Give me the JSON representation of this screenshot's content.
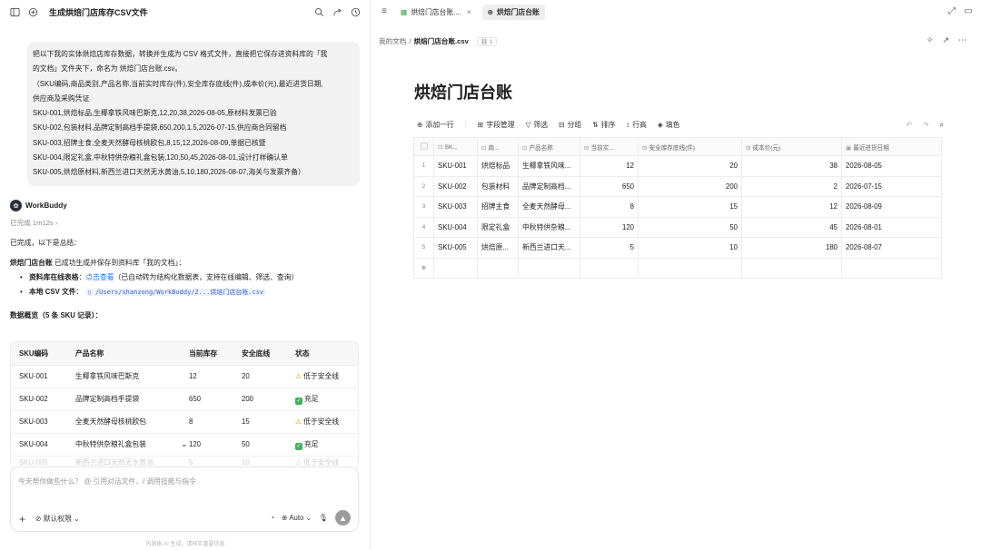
{
  "left_header": {
    "title": "生成烘焙门店库存CSV文件"
  },
  "user_message": {
    "lines": [
      "把以下我的实体烘焙店库存数据，转换并生成为 CSV 格式文件，直接把它保存进资料库的「我",
      "的文档」文件夹下，命名为 烘焙门店台账.csv。",
      "（SKU编码,商品类别,产品名称,当前实时库存(件),安全库存底线(件),成本价(元),最近进货日期,",
      "供应商及采购凭证",
      "SKU-001,烘焙标品,生椰拿铁风味巴斯克,12,20,38,2026-08-05,原材料发票已验",
      "SKU-002,包装材料,品牌定制高档手提袋,650,200,1.5,2026-07-15,供应商合同留档",
      "SKU-003,招牌主食,全麦天然酵母核桃欧包,8,15,12,2026-08-09,单据已核暨",
      "SKU-004,限定礼盒,中秋特供杂粮礼盒包装,120,50,45,2026-08-01,设计打样确认单",
      "SKU-005,烘焙原材料,新西兰进口天然无水黄油,5,10,180,2026-08-07,海关与发票齐备）"
    ]
  },
  "agent": {
    "name": "WorkBuddy",
    "status": "已完成 1m12s",
    "summary_intro": "已完成，以下是总结：",
    "result_title": "烘焙门店台账",
    "result_text": " 已成功生成并保存到资料库「我的文档」：",
    "bullet1_label": "资料库在线表格",
    "bullet1_link": "点击查看",
    "bullet1_note": "（已自动转为结构化数据表，支持在线编辑、筛选、查询）",
    "bullet2_label": "本地 CSV 文件",
    "bullet2_path": "/Users/shanzong/WorkBuddy/2...烘焙门店台账.csv",
    "overview_title": "数据概览（5 条 SKU 记录）："
  },
  "summary_table": {
    "headers": [
      "SKU编码",
      "产品名称",
      "当前库存",
      "安全底线",
      "状态"
    ],
    "rows": [
      [
        "SKU-001",
        "生椰拿铁风味巴斯克",
        "12",
        "20",
        "低于安全线"
      ],
      [
        "SKU-002",
        "品牌定制高档手提袋",
        "650",
        "200",
        "充足"
      ],
      [
        "SKU-003",
        "全麦天然酵母核桃欧包",
        "8",
        "15",
        "低于安全线"
      ],
      [
        "SKU-004",
        "中秋特供杂粮礼盒包装",
        "120",
        "50",
        "充足"
      ],
      [
        "SKU-005",
        "新西兰进口天然无水黄油",
        "5",
        "10",
        "低于安全线"
      ]
    ]
  },
  "input": {
    "placeholder": "今天帮你做些什么？ @ 引用对话文件，/ 调用技能与指令",
    "permission": "默认权限",
    "model": "Auto"
  },
  "footnote": "内容由 AI 生成，请核实重要信息",
  "right_tabs": [
    {
      "label": "烘焙门店台账...."
    },
    {
      "label": "烘焙门店台账"
    }
  ],
  "breadcrumb": {
    "folder": "我的文档",
    "file": "烘焙门店台账.csv",
    "count": "1"
  },
  "doc_title": "烘焙门店台账",
  "toolbar": {
    "add_row": "添加一行",
    "fields": "字段管理",
    "filter": "筛选",
    "group": "分组",
    "sort": "排序",
    "row_height": "行高",
    "fill": "填色"
  },
  "grid": {
    "headers": [
      "SK...",
      "商...",
      "产品名称",
      "当前实...",
      "安全库存底线(件)",
      "成本价(元)",
      "最近进货日期"
    ],
    "rows": [
      [
        "1",
        "SKU-001",
        "烘焙标品",
        "生椰拿铁风味...",
        "12",
        "20",
        "38",
        "2026-08-05"
      ],
      [
        "2",
        "SKU-002",
        "包装材料",
        "品牌定制高档...",
        "650",
        "200",
        "2",
        "2026-07-15"
      ],
      [
        "3",
        "SKU-003",
        "招牌主食",
        "全麦天然酵母...",
        "8",
        "15",
        "12",
        "2026-08-09"
      ],
      [
        "4",
        "SKU-004",
        "限定礼盒",
        "中秋特供杂粮...",
        "120",
        "50",
        "45",
        "2026-08-01"
      ],
      [
        "5",
        "SKU-005",
        "烘焙原...",
        "新西兰进口天...",
        "5",
        "10",
        "180",
        "2026-08-07"
      ]
    ]
  }
}
